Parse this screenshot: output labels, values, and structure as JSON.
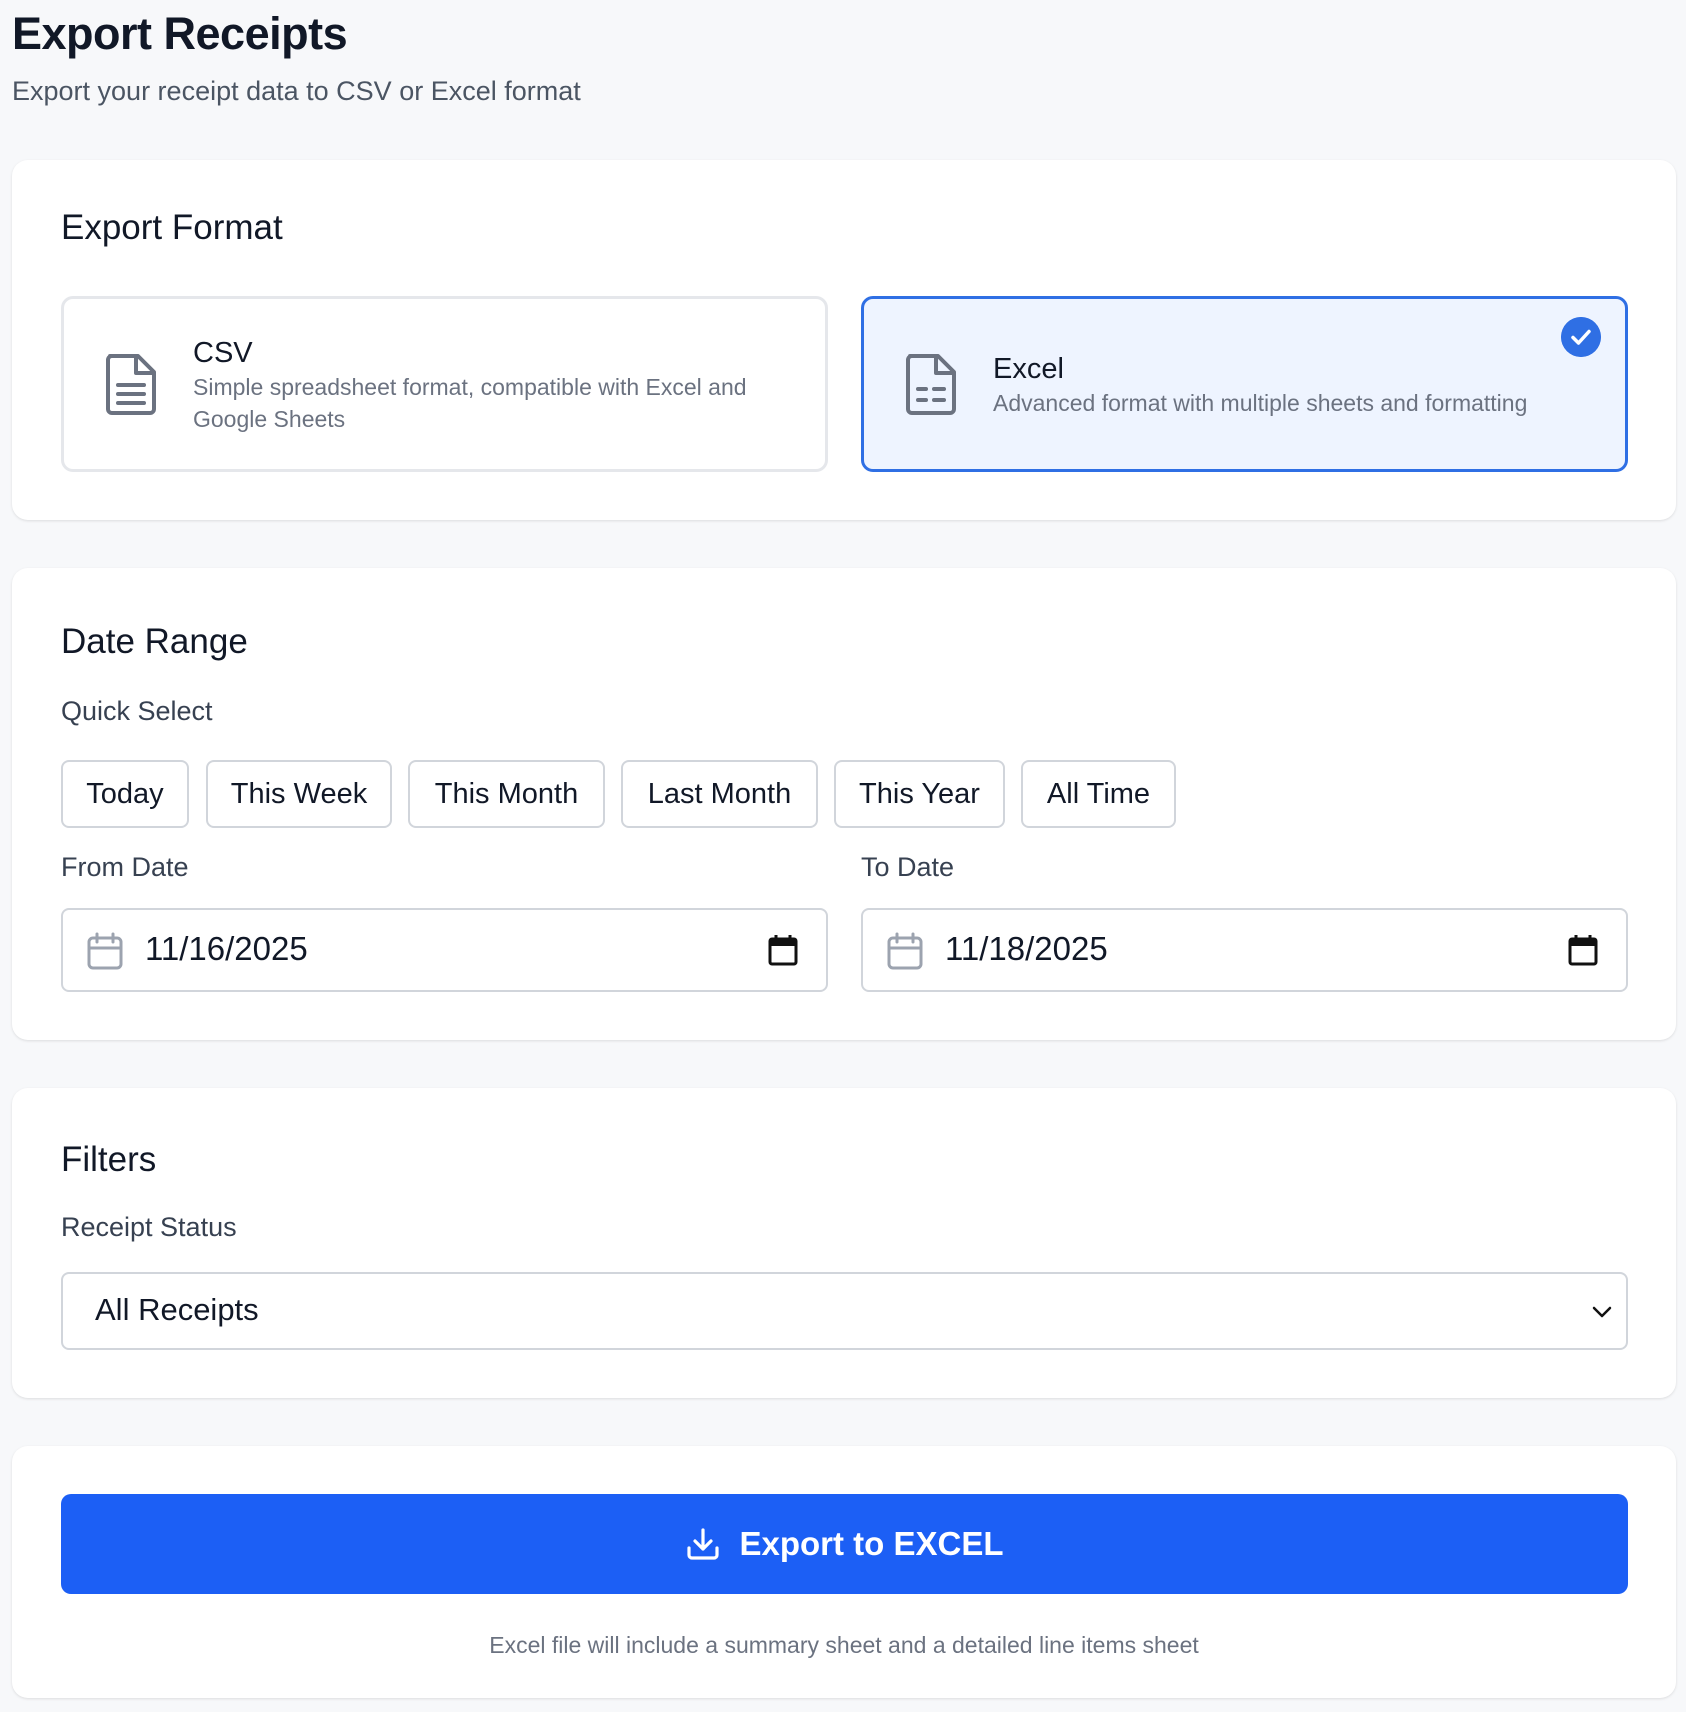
{
  "header": {
    "title": "Export Receipts",
    "subtitle": "Export your receipt data to CSV or Excel format"
  },
  "export_format": {
    "heading": "Export Format",
    "selected": "Excel",
    "options": [
      {
        "name": "CSV",
        "description": "Simple spreadsheet format, compatible with Excel and Google Sheets",
        "icon": "document-text-icon"
      },
      {
        "name": "Excel",
        "description": "Advanced format with multiple sheets and formatting",
        "icon": "document-table-icon"
      }
    ]
  },
  "date_range": {
    "heading": "Date Range",
    "quick_select_label": "Quick Select",
    "quick_options": [
      "Today",
      "This Week",
      "This Month",
      "Last Month",
      "This Year",
      "All Time"
    ],
    "from_label": "From Date",
    "from_value": "11/16/2025",
    "to_label": "To Date",
    "to_value": "11/18/2025"
  },
  "filters": {
    "heading": "Filters",
    "status_label": "Receipt Status",
    "status_value": "All Receipts"
  },
  "export": {
    "button_label": "Export to EXCEL",
    "note": "Excel file will include a summary sheet and a detailed line items sheet"
  },
  "colors": {
    "accent": "#1c5ff5",
    "selected_border": "#2f6fe4",
    "selected_bg": "#eef4ff"
  }
}
